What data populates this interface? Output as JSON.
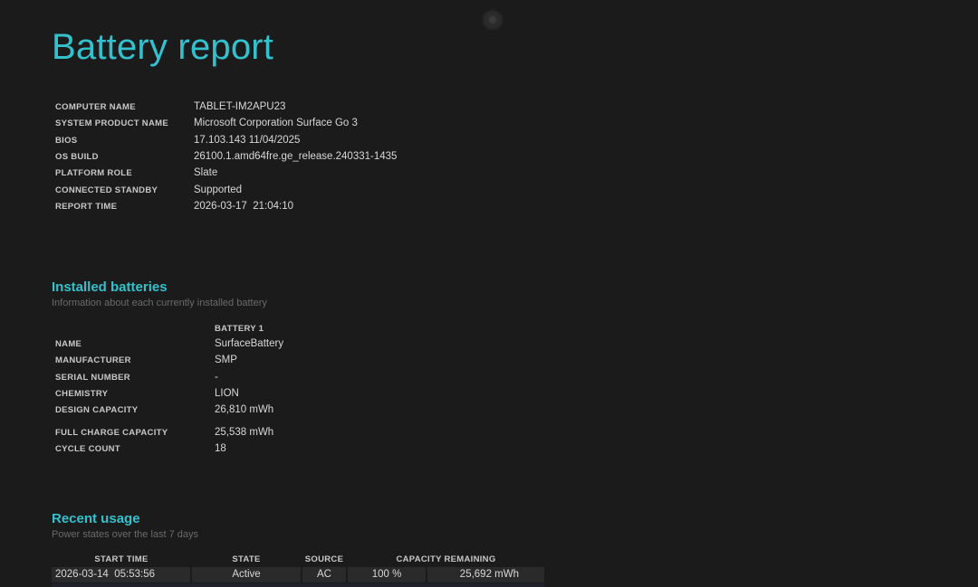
{
  "title": "Battery report",
  "system_info": [
    {
      "label": "COMPUTER NAME",
      "value": "TABLET-IM2APU23"
    },
    {
      "label": "SYSTEM PRODUCT NAME",
      "value": "Microsoft Corporation Surface Go 3"
    },
    {
      "label": "BIOS",
      "value": "17.103.143 11/04/2025"
    },
    {
      "label": "OS BUILD",
      "value": "26100.1.amd64fre.ge_release.240331-1435"
    },
    {
      "label": "PLATFORM ROLE",
      "value": "Slate"
    },
    {
      "label": "CONNECTED STANDBY",
      "value": "Supported"
    },
    {
      "label": "REPORT TIME",
      "value": "2026-03-17  21:04:10"
    }
  ],
  "installed_batteries": {
    "heading": "Installed batteries",
    "subtitle": "Information about each currently installed battery",
    "column_header": "BATTERY 1",
    "rows": [
      {
        "label": "NAME",
        "value": "SurfaceBattery"
      },
      {
        "label": "MANUFACTURER",
        "value": "SMP"
      },
      {
        "label": "SERIAL NUMBER",
        "value": "-"
      },
      {
        "label": "CHEMISTRY",
        "value": "LION"
      },
      {
        "label": "DESIGN CAPACITY",
        "value": "26,810 mWh"
      },
      {
        "label": "FULL CHARGE CAPACITY",
        "value": "25,538 mWh"
      },
      {
        "label": "CYCLE COUNT",
        "value": "18"
      }
    ]
  },
  "recent_usage": {
    "heading": "Recent usage",
    "subtitle": "Power states over the last 7 days",
    "columns": [
      "START TIME",
      "STATE",
      "SOURCE",
      "CAPACITY REMAINING"
    ],
    "rows": [
      {
        "start_time": "2026-03-14  05:53:56",
        "state": "Active",
        "source": "AC",
        "percent": "100 %",
        "mwh": "25,692 mWh"
      }
    ]
  }
}
